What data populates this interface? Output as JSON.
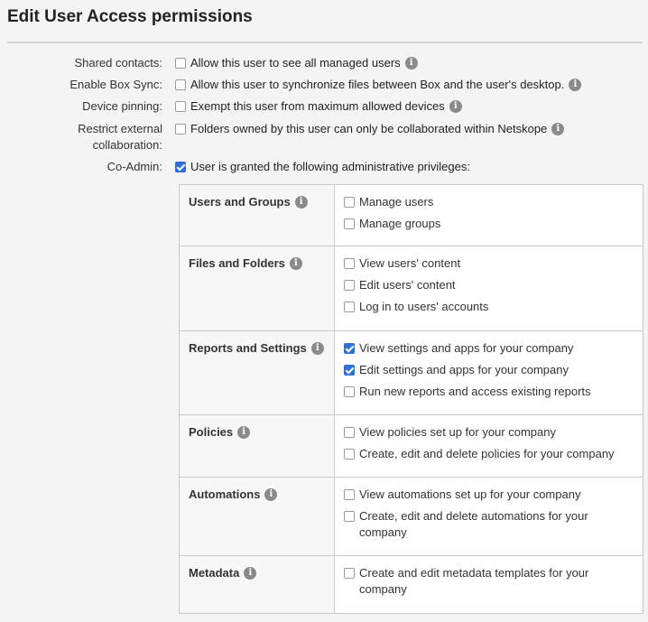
{
  "page": {
    "title": "Edit User Access permissions"
  },
  "settings": [
    {
      "label": "Shared contacts:",
      "text": "Allow this user to see all managed users",
      "checked": false,
      "info": true
    },
    {
      "label": "Enable Box Sync:",
      "text": "Allow this user to synchronize files between Box and the user's desktop.",
      "checked": false,
      "info": true
    },
    {
      "label": "Device pinning:",
      "text": "Exempt this user from maximum allowed devices",
      "checked": false,
      "info": true
    },
    {
      "label_line1": "Restrict external",
      "label_line2": "collaboration:",
      "text": "Folders owned by this user can only be collaborated within Netskope",
      "checked": false,
      "info": true
    },
    {
      "label": "Co-Admin:",
      "text": "User is granted the following administrative privileges:",
      "checked": true,
      "info": false
    }
  ],
  "info_glyph": "i",
  "privileges": [
    {
      "category": "Users and Groups",
      "options": [
        {
          "text": "Manage users",
          "checked": false
        },
        {
          "text": "Manage groups",
          "checked": false
        }
      ]
    },
    {
      "category": "Files and Folders",
      "options": [
        {
          "text": "View users' content",
          "checked": false
        },
        {
          "text": "Edit users' content",
          "checked": false
        },
        {
          "text": "Log in to users' accounts",
          "checked": false
        }
      ]
    },
    {
      "category": "Reports and Settings",
      "options": [
        {
          "text": "View settings and apps for your company",
          "checked": true
        },
        {
          "text": "Edit settings and apps for your company",
          "checked": true
        },
        {
          "text": "Run new reports and access existing reports",
          "checked": false
        }
      ]
    },
    {
      "category": "Policies",
      "options": [
        {
          "text": "View policies set up for your company",
          "checked": false
        },
        {
          "text": "Create, edit and delete policies for your company",
          "checked": false
        }
      ]
    },
    {
      "category": "Automations",
      "options": [
        {
          "text": "View automations set up for your company",
          "checked": false
        },
        {
          "text": "Create, edit and delete automations for your company",
          "checked": false
        }
      ]
    },
    {
      "category": "Metadata",
      "options": [
        {
          "text": "Create and edit metadata templates for your company",
          "checked": false
        }
      ]
    }
  ],
  "colors": {
    "accent": "#2f6fd6",
    "info_icon": "#8a8a8a",
    "background": "#f4f4f4"
  }
}
